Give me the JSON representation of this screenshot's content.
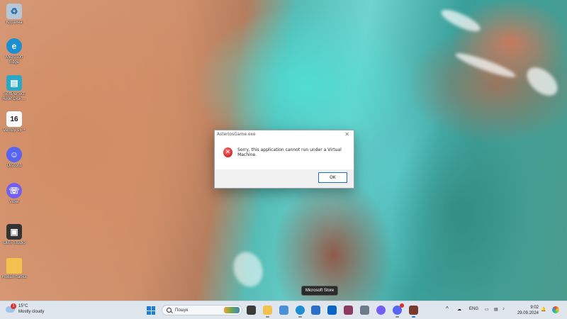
{
  "desktop": {
    "icons": [
      {
        "label": "Корзина",
        "icon": "recycle-bin-icon",
        "color": "#b6c7d8"
      },
      {
        "label": "Microsoft Edge",
        "icon": "edge-icon",
        "color": "#1b8fd1"
      },
      {
        "label": "SoftPerfect RAM Disk ...",
        "icon": "ram-disk-icon",
        "color": "#2aa8c8"
      },
      {
        "label": "Ventoy 16 +",
        "icon": "numbered-app-icon",
        "color": "#ffffff"
      },
      {
        "label": "Discord",
        "icon": "discord-icon",
        "color": "#5865f2"
      },
      {
        "label": "Viber",
        "icon": "viber-icon",
        "color": "#7360f2"
      },
      {
        "label": "OBS Studio",
        "icon": "obs-icon",
        "color": "#333333"
      },
      {
        "label": "Новая папка",
        "icon": "folder-icon",
        "color": "#f2c14e"
      }
    ],
    "icon_number": "16"
  },
  "dialog": {
    "title": "AsteriosGame.exe",
    "close_glyph": "✕",
    "error_glyph": "✕",
    "message": "Sorry, this application cannot run under a Virtual Machine.",
    "ok_label": "OK"
  },
  "tooltip": {
    "text": "Microsoft Store"
  },
  "taskbar": {
    "weather": {
      "temp": "15°C",
      "condition": "Mostly cloudy",
      "badge": "1"
    },
    "search_placeholder": "Пошук",
    "apps": [
      {
        "name": "task-view",
        "color": "#3b3b3b"
      },
      {
        "name": "file-explorer",
        "color": "#f2c14e"
      },
      {
        "name": "photos",
        "color": "#4a90d9"
      },
      {
        "name": "edge",
        "color": "#1b8fd1"
      },
      {
        "name": "microsoft-store",
        "color": "#2a6fc9"
      },
      {
        "name": "outlook",
        "color": "#0a64c8"
      },
      {
        "name": "winrar",
        "color": "#8b3a62"
      },
      {
        "name": "file-manager",
        "color": "#6c7a89"
      },
      {
        "name": "viber",
        "color": "#7360f2"
      },
      {
        "name": "discord",
        "color": "#5865f2"
      },
      {
        "name": "game-launcher",
        "color": "#7a3b2e"
      }
    ],
    "tray": {
      "chevron": "^",
      "language": "ENG",
      "time": "9:02",
      "date": "29.09.2024"
    }
  }
}
